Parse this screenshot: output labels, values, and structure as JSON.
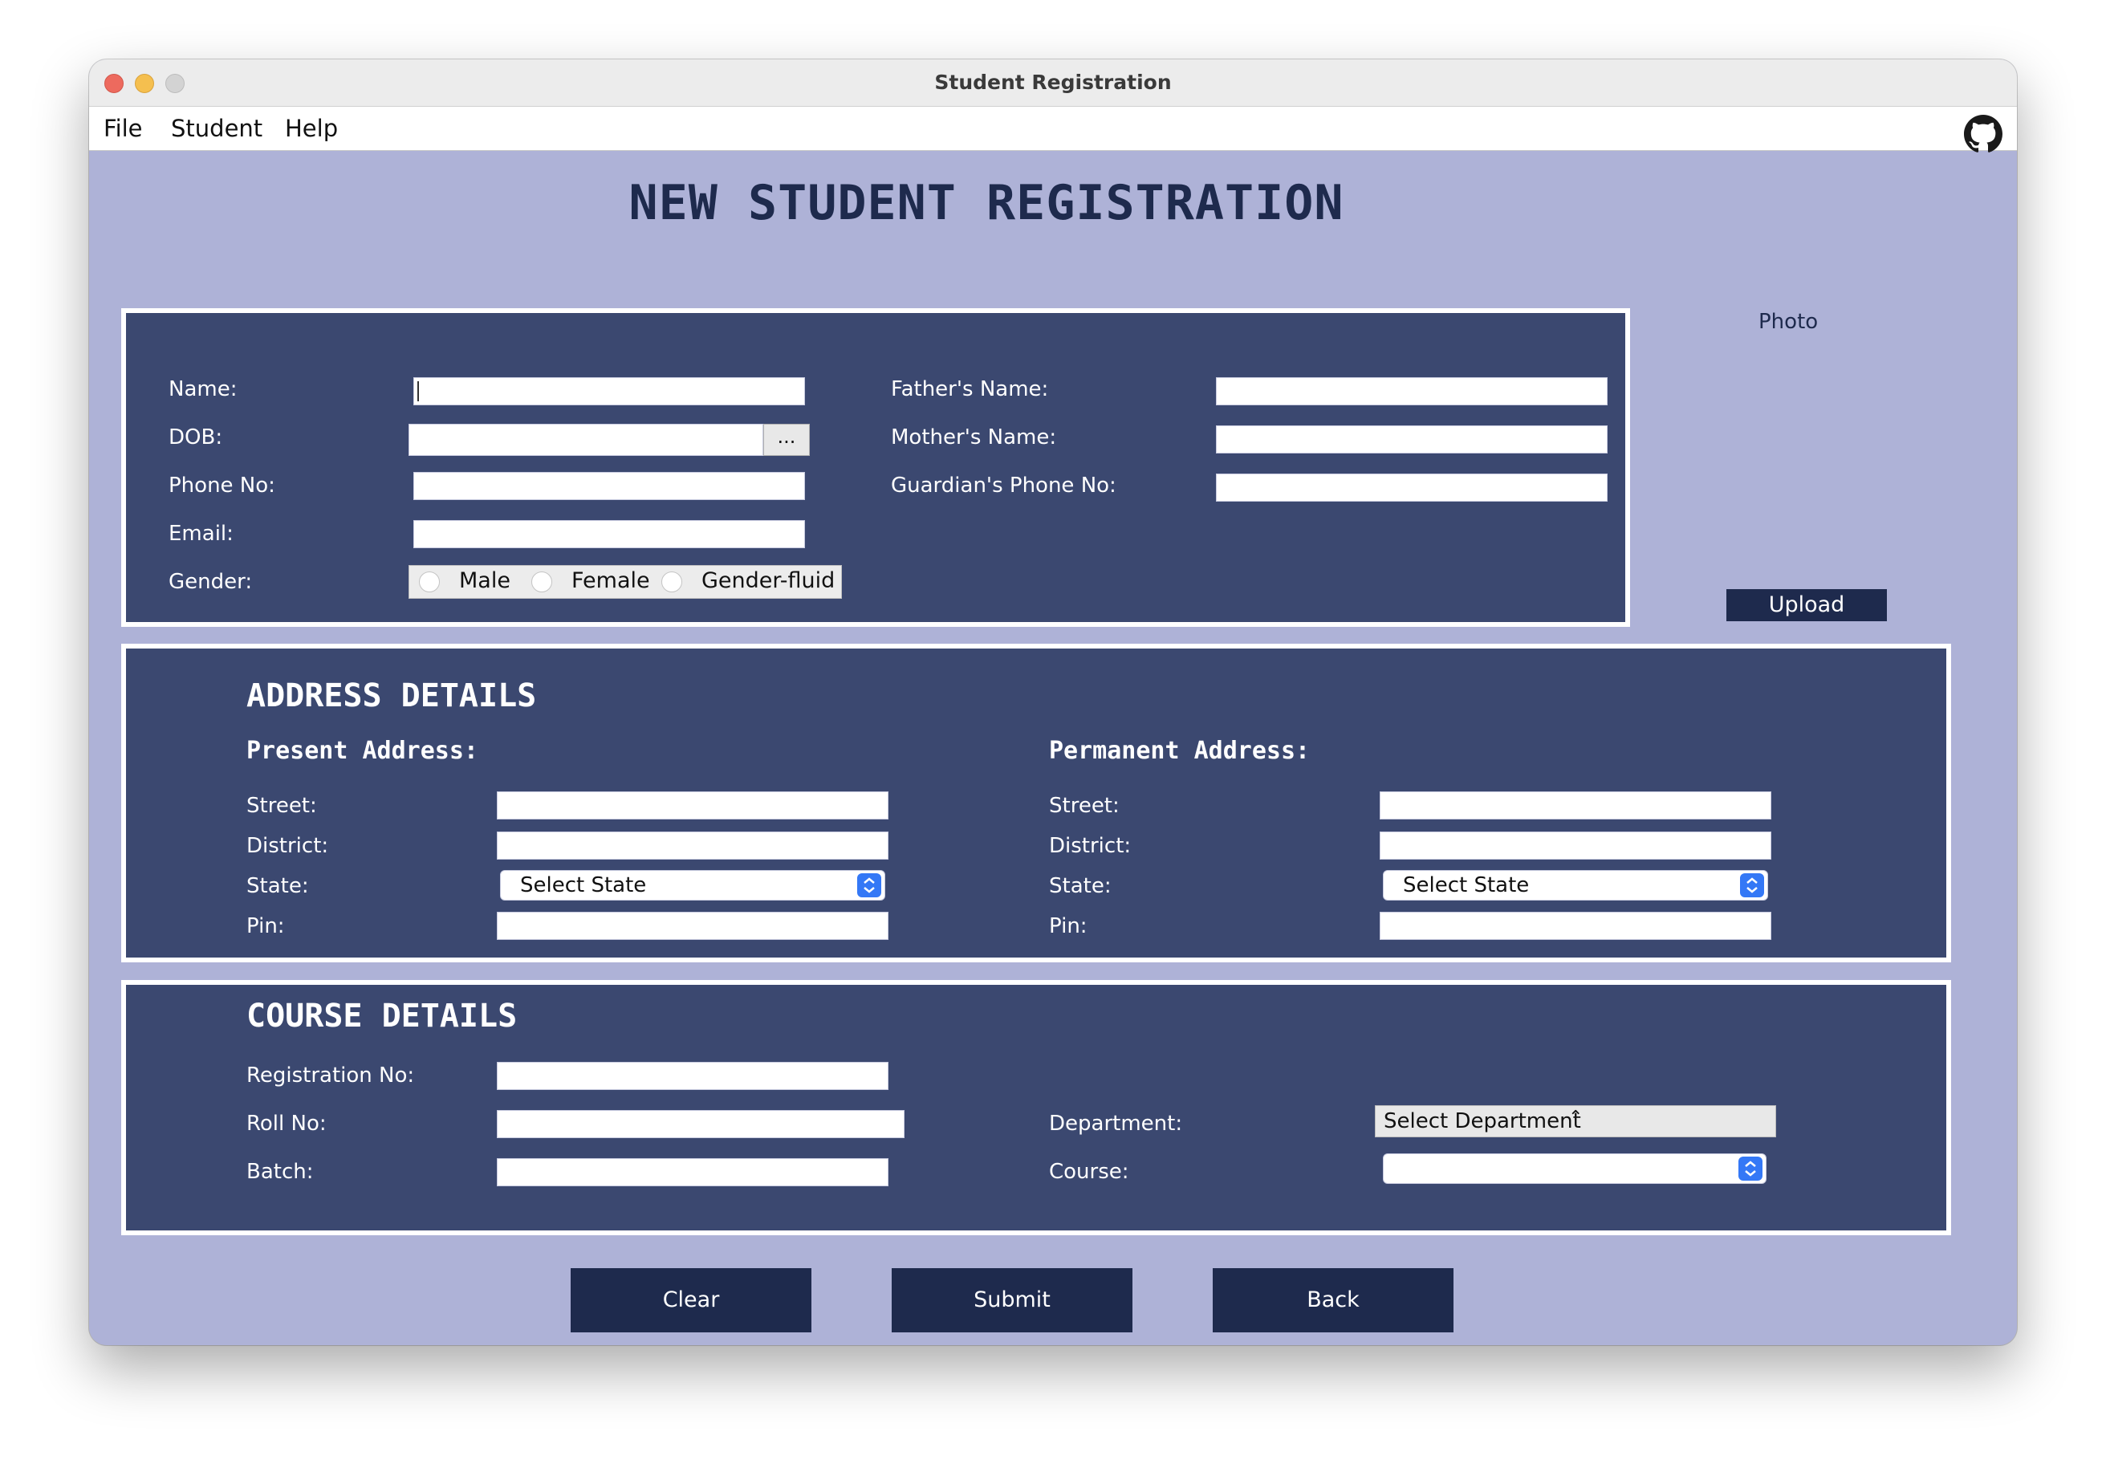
{
  "window": {
    "title": "Student Registration"
  },
  "menu": {
    "items": [
      "File",
      "Student",
      "Help"
    ]
  },
  "icons": {
    "github": "github-icon",
    "dob_picker": "ellipsis-icon",
    "select_arrow": "updown-chevron-icon"
  },
  "colors": {
    "background": "#aeb2d7",
    "panel": "#3b4870",
    "button": "#1e2a4d",
    "select_accent": "#3478f6"
  },
  "heading": "NEW STUDENT REGISTRATION",
  "personal": {
    "name_label": "Name:",
    "name_value": "",
    "dob_label": "DOB:",
    "dob_value": "",
    "dob_button": "...",
    "phone_label": "Phone No:",
    "email_label": "Email:",
    "gender_label": "Gender:",
    "gender_options": [
      "Male",
      "Female",
      "Gender-fluid"
    ],
    "father_label": "Father's Name:",
    "mother_label": "Mother's Name:",
    "guardian_phone_label": "Guardian's Phone No:"
  },
  "photo": {
    "label": "Photo",
    "upload_button": "Upload"
  },
  "address": {
    "title": "ADDRESS DETAILS",
    "present": {
      "title": "Present Address:",
      "street_label": "Street:",
      "district_label": "District:",
      "state_label": "State:",
      "state_value": "Select State",
      "pin_label": "Pin:"
    },
    "permanent": {
      "title": "Permanent Address:",
      "street_label": "Street:",
      "district_label": "District:",
      "state_label": "State:",
      "state_value": "Select State",
      "pin_label": "Pin:"
    }
  },
  "course": {
    "title": "COURSE DETAILS",
    "registration_label": "Registration No:",
    "roll_label": "Roll No:",
    "batch_label": "Batch:",
    "department_label": "Department:",
    "department_value": "Select Department",
    "course_label": "Course:",
    "course_value": ""
  },
  "actions": {
    "clear": "Clear",
    "submit": "Submit",
    "back": "Back"
  }
}
